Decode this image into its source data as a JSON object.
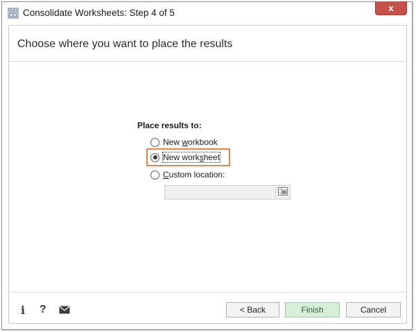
{
  "window": {
    "title": "Consolidate Worksheets: Step 4 of 5",
    "close_label": "x",
    "icon": "consolidate-worksheets-icon"
  },
  "header": {
    "text": "Choose where you want to place the results"
  },
  "placement": {
    "label": "Place results to:",
    "options": [
      {
        "pre": "New ",
        "accel": "w",
        "post": "orkbook",
        "selected": false
      },
      {
        "pre": "New work",
        "accel": "s",
        "post": "heet",
        "selected": true
      },
      {
        "pre": "",
        "accel": "C",
        "post": "ustom location:",
        "selected": false
      }
    ],
    "custom_location_value": "",
    "range_picker_icon": "range-select-icon",
    "highlight_color": "#e8823a"
  },
  "footer": {
    "icons": [
      "info-icon",
      "help-icon",
      "mail-icon"
    ],
    "info_glyph": "i",
    "help_glyph": "?",
    "back_label": "< Back",
    "finish_label": "Finish",
    "cancel_label": "Cancel"
  },
  "colors": {
    "close_button": "#c7504a",
    "finish_button": "#d7eed8"
  }
}
